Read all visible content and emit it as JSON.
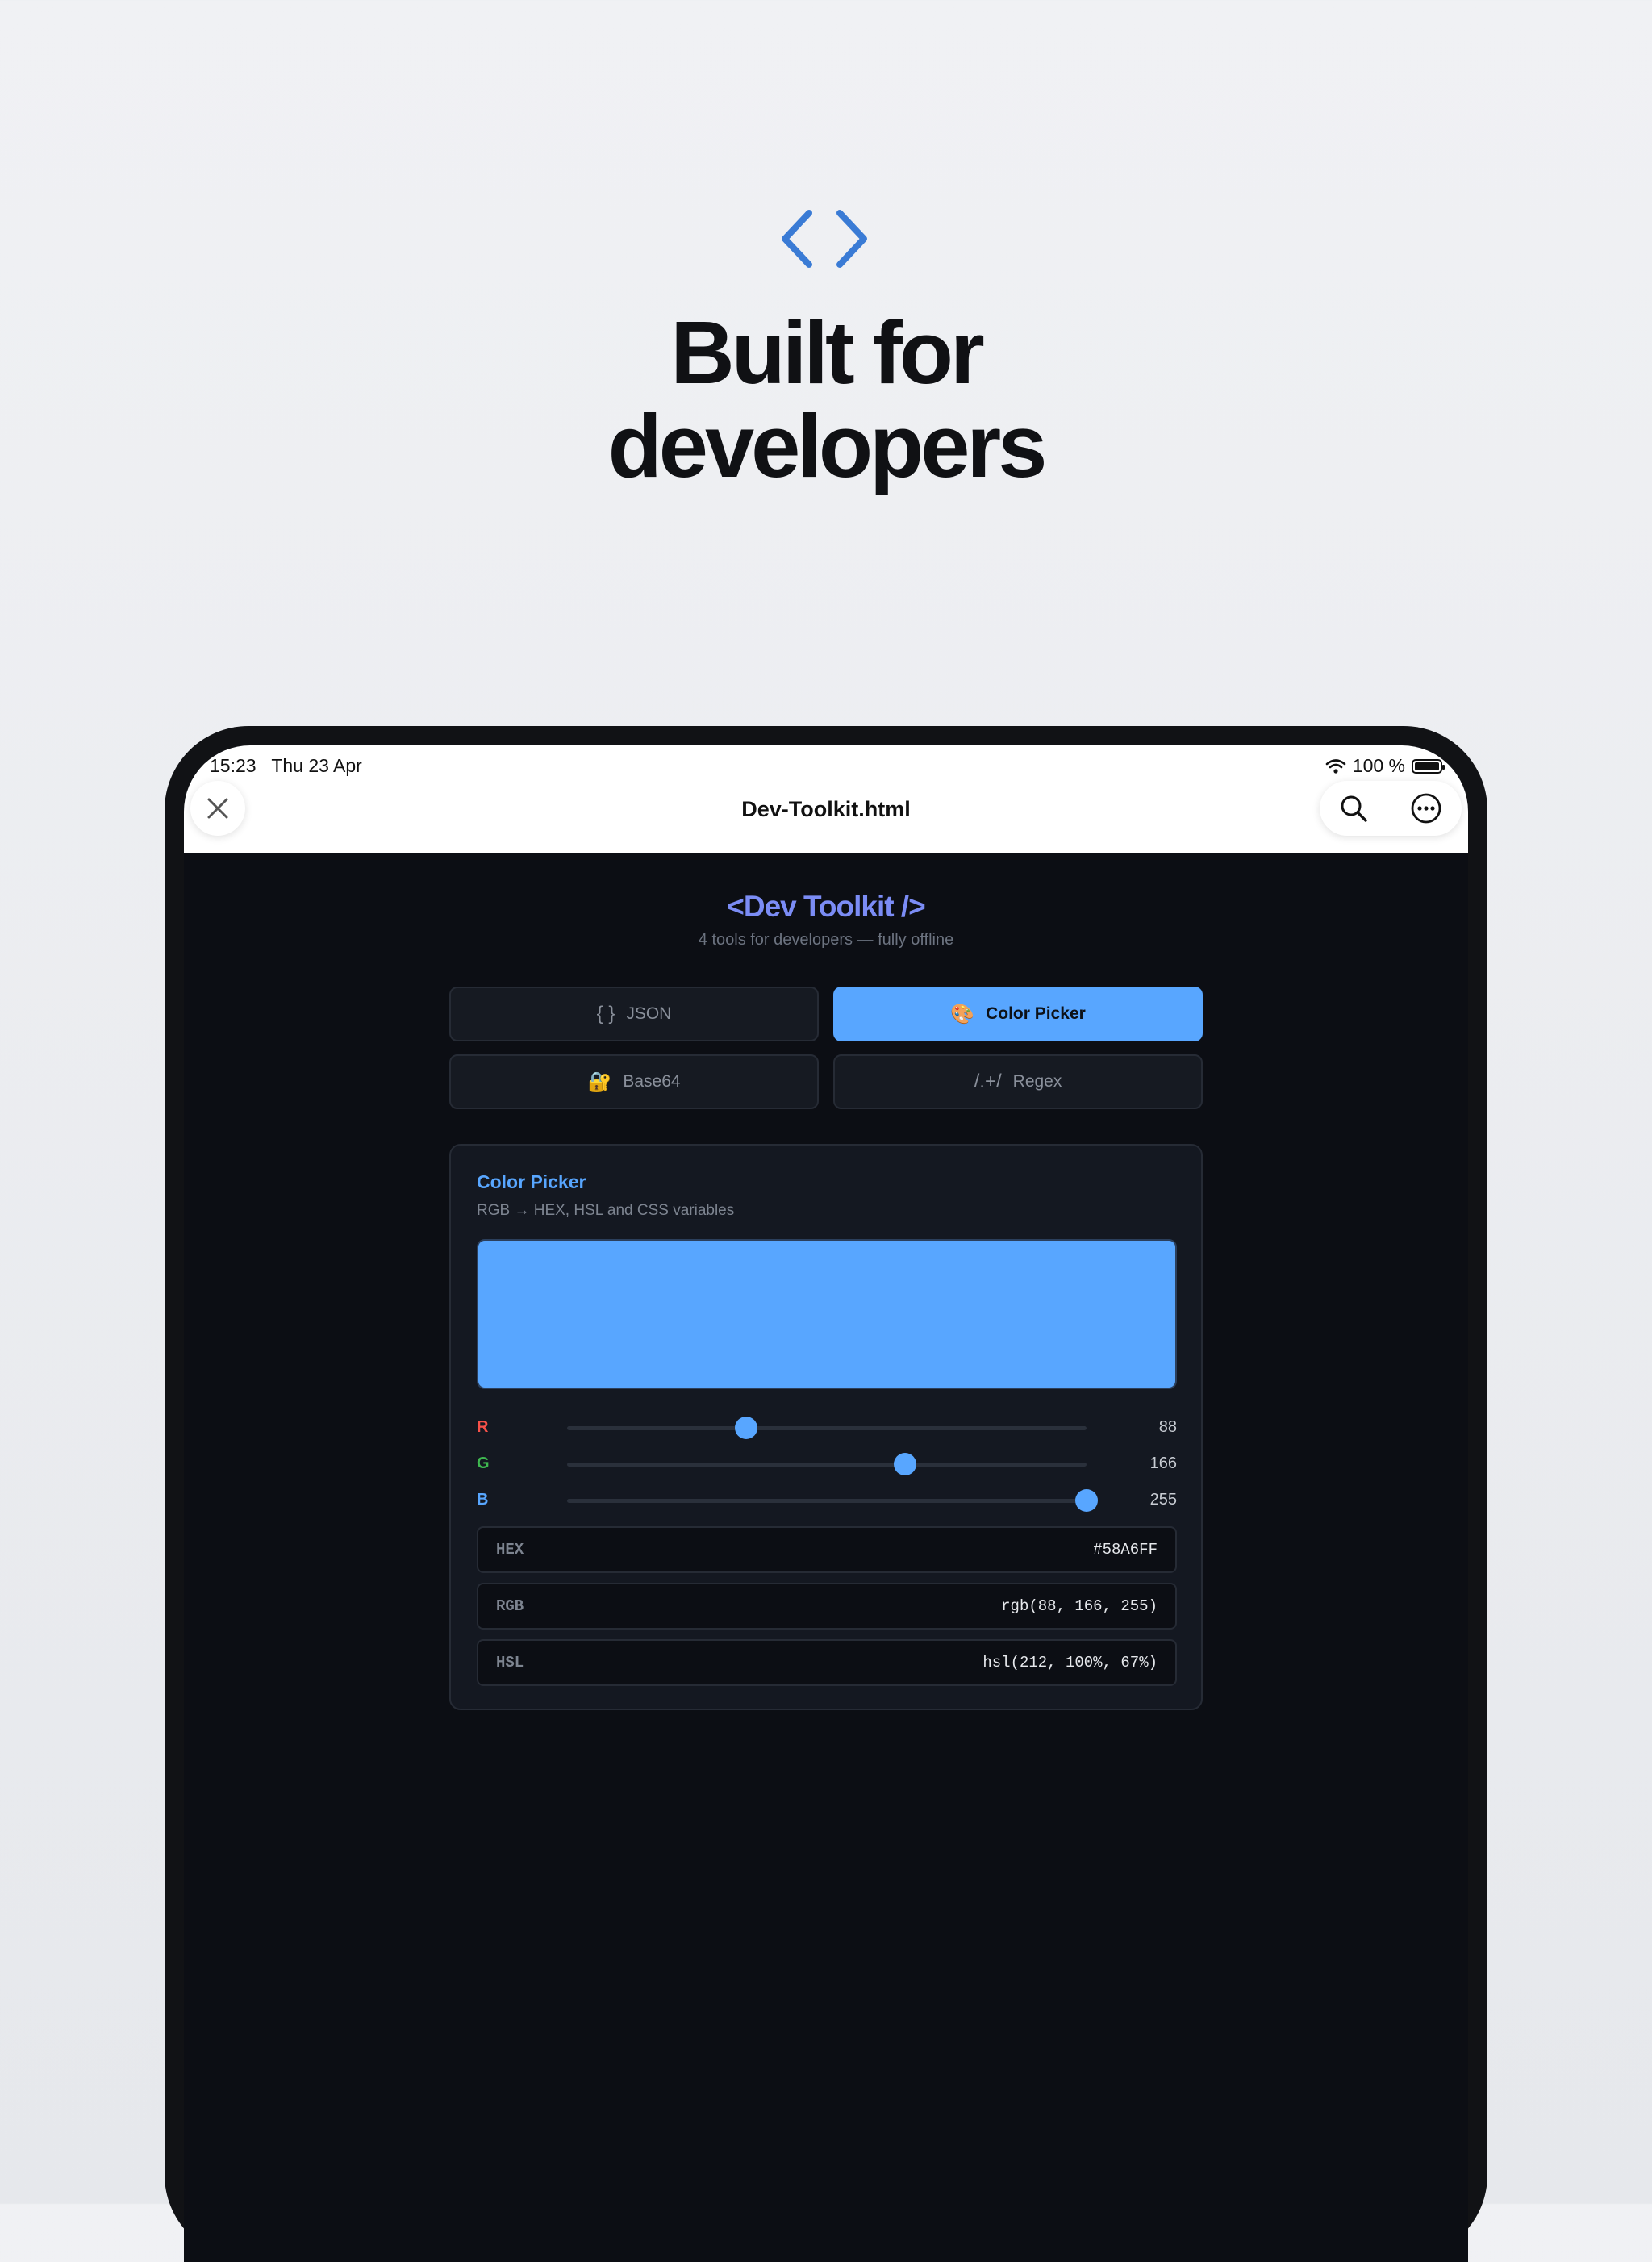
{
  "hero": {
    "icon": "code-brackets-icon",
    "headline_line1": "Built for",
    "headline_line2": "developers"
  },
  "status_bar": {
    "time": "15:23",
    "date": "Thu 23 Apr",
    "battery": "100 %"
  },
  "browser": {
    "page_title": "Dev-Toolkit.html",
    "close_icon": "close-icon",
    "search_icon": "search-icon",
    "more_icon": "more-icon"
  },
  "app": {
    "title": "<Dev Toolkit />",
    "subtitle": "4 tools for developers — fully offline",
    "tabs": [
      {
        "icon": "{ }",
        "label": "JSON",
        "active": false
      },
      {
        "icon": "🎨",
        "label": "Color Picker",
        "active": true
      },
      {
        "icon": "🔐",
        "label": "Base64",
        "active": false
      },
      {
        "icon": "/.+/",
        "label": "Regex",
        "active": false
      }
    ]
  },
  "color_picker": {
    "title": "Color Picker",
    "subtitle": "RGB → HEX, HSL and CSS variables",
    "color": "#58A6FF",
    "sliders": [
      {
        "label": "R",
        "value": "88",
        "color": "#f85149",
        "max": 255
      },
      {
        "label": "G",
        "value": "166",
        "color": "#3fb950",
        "max": 255
      },
      {
        "label": "B",
        "value": "255",
        "color": "#58a6ff",
        "max": 255
      }
    ],
    "outputs": [
      {
        "label": "HEX",
        "value": "#58A6FF"
      },
      {
        "label": "RGB",
        "value": "rgb(88, 166, 255)"
      },
      {
        "label": "HSL",
        "value": "hsl(212, 100%, 67%)"
      }
    ]
  },
  "colors": {
    "accent": "#58a6ff",
    "title_purple": "#7b8cf5",
    "hero_icon": "#3a7bd5",
    "app_background": "#0c0e14"
  }
}
